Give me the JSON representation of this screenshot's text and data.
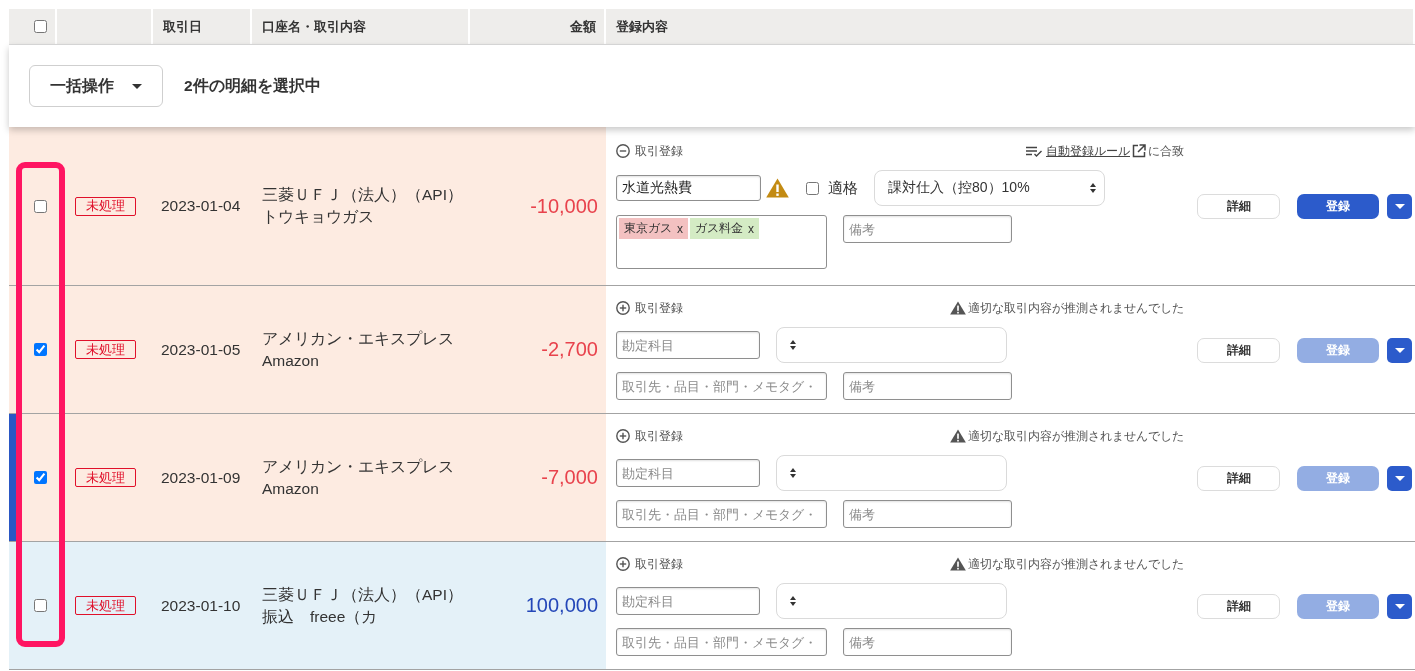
{
  "header": {
    "select_all": {
      "checked": false
    },
    "columns": [
      "取引日",
      "口座名・取引内容",
      "金額",
      "登録内容"
    ]
  },
  "bulk_bar": {
    "action_button": "一括操作",
    "selection_summary": "2件の明細を選択中"
  },
  "rows": [
    {
      "checked": false,
      "focused": false,
      "kind": "expense",
      "status": "未処理",
      "date": "2023-01-04",
      "account": "三菱ＵＦＪ（法人）（API）",
      "description": "トウキョウガス",
      "amount": "-10,000",
      "entry": {
        "expanded": true,
        "label": "取引登録",
        "notice": {
          "kind": "rule",
          "link": "自動登録ルール",
          "text": "に合致"
        },
        "account_field": {
          "value": "水道光熱費",
          "warning": true
        },
        "qualified": {
          "label": "適格",
          "checked": false
        },
        "tax_value": "課対仕入（控80）10%",
        "tags_field": {
          "tags": [
            {
              "label": "東京ガス",
              "remove": "x",
              "color": "#f3c1c1"
            },
            {
              "label": "ガス料金",
              "remove": "x",
              "color": "#d4ebc4"
            }
          ]
        },
        "memo_field": {
          "placeholder": "備考"
        },
        "detail_button": "詳細",
        "register_button": {
          "label": "登録",
          "disabled": false
        }
      }
    },
    {
      "checked": true,
      "focused": false,
      "kind": "expense",
      "status": "未処理",
      "date": "2023-01-05",
      "account": "アメリカン・エキスプレス",
      "description": "Amazon",
      "amount": "-2,700",
      "entry": {
        "expanded": false,
        "label": "取引登録",
        "notice": {
          "kind": "warning",
          "text": "適切な取引内容が推測されませんでした"
        },
        "account_field": {
          "placeholder": "勘定科目",
          "warning": false
        },
        "tags_field": {
          "placeholder": "取引先・品目・部門・メモタグ・"
        },
        "memo_field": {
          "placeholder": "備考"
        },
        "detail_button": "詳細",
        "register_button": {
          "label": "登録",
          "disabled": true
        }
      }
    },
    {
      "checked": true,
      "focused": true,
      "kind": "expense",
      "status": "未処理",
      "date": "2023-01-09",
      "account": "アメリカン・エキスプレス",
      "description": "Amazon",
      "amount": "-7,000",
      "entry": {
        "expanded": false,
        "label": "取引登録",
        "notice": {
          "kind": "warning",
          "text": "適切な取引内容が推測されませんでした"
        },
        "account_field": {
          "placeholder": "勘定科目",
          "warning": false
        },
        "tags_field": {
          "placeholder": "取引先・品目・部門・メモタグ・"
        },
        "memo_field": {
          "placeholder": "備考"
        },
        "detail_button": "詳細",
        "register_button": {
          "label": "登録",
          "disabled": true
        }
      }
    },
    {
      "checked": false,
      "focused": false,
      "kind": "income",
      "status": "未処理",
      "date": "2023-01-10",
      "account": "三菱ＵＦＪ（法人）（API）",
      "description": "振込　freee（カ",
      "amount": "100,000",
      "entry": {
        "expanded": false,
        "label": "取引登録",
        "notice": {
          "kind": "warning",
          "text": "適切な取引内容が推測されませんでした"
        },
        "account_field": {
          "placeholder": "勘定科目",
          "warning": false
        },
        "tags_field": {
          "placeholder": "取引先・品目・部門・メモタグ・"
        },
        "memo_field": {
          "placeholder": "備考"
        },
        "detail_button": "詳細",
        "register_button": {
          "label": "登録",
          "disabled": true
        }
      }
    }
  ]
}
